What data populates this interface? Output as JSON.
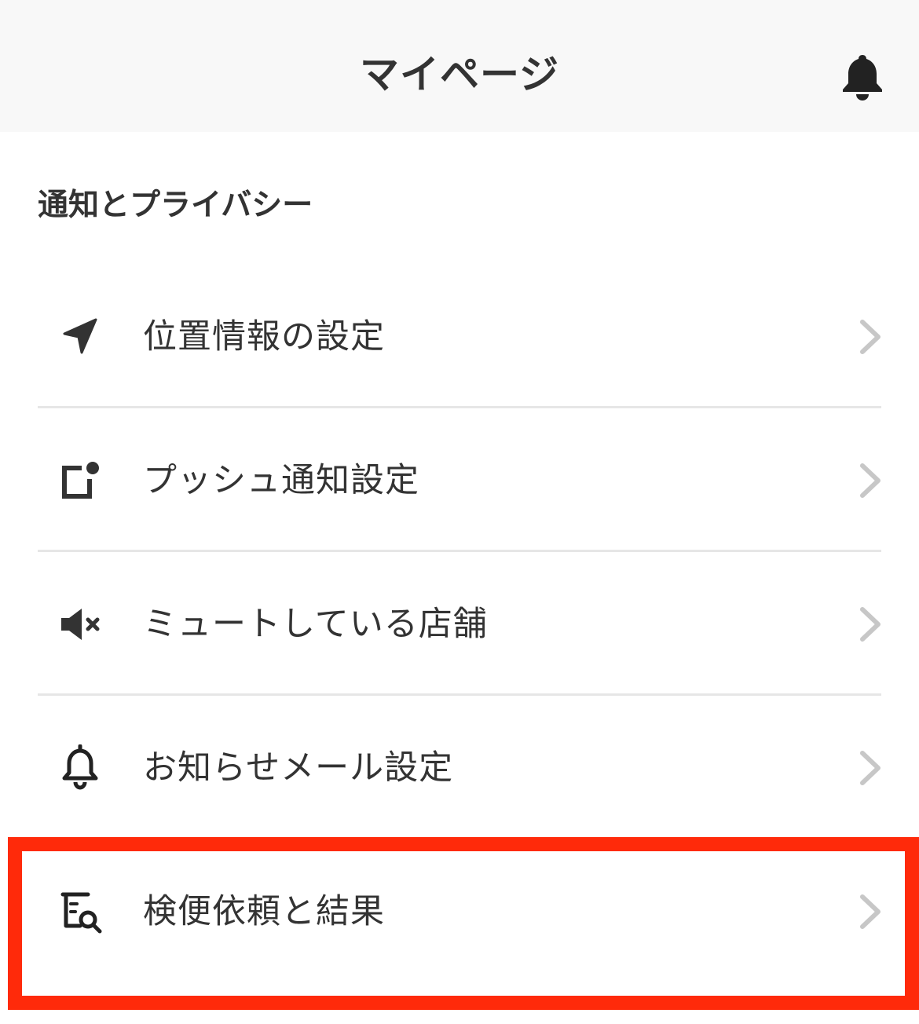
{
  "header": {
    "title": "マイページ",
    "notification_icon": "bell-icon"
  },
  "section": {
    "title": "通知とプライバシー"
  },
  "menu": [
    {
      "label": "位置情報の設定",
      "icon": "location-arrow-icon"
    },
    {
      "label": "プッシュ通知設定",
      "icon": "push-notification-icon"
    },
    {
      "label": "ミュートしている店舗",
      "icon": "mute-speaker-icon"
    },
    {
      "label": "お知らせメール設定",
      "icon": "bell-outline-icon"
    },
    {
      "label": "検便依頼と結果",
      "icon": "sample-search-icon"
    }
  ],
  "colors": {
    "highlight": "#ff2a0a",
    "chevron": "#c7c7c7",
    "header_bg": "#f8f8f8"
  }
}
